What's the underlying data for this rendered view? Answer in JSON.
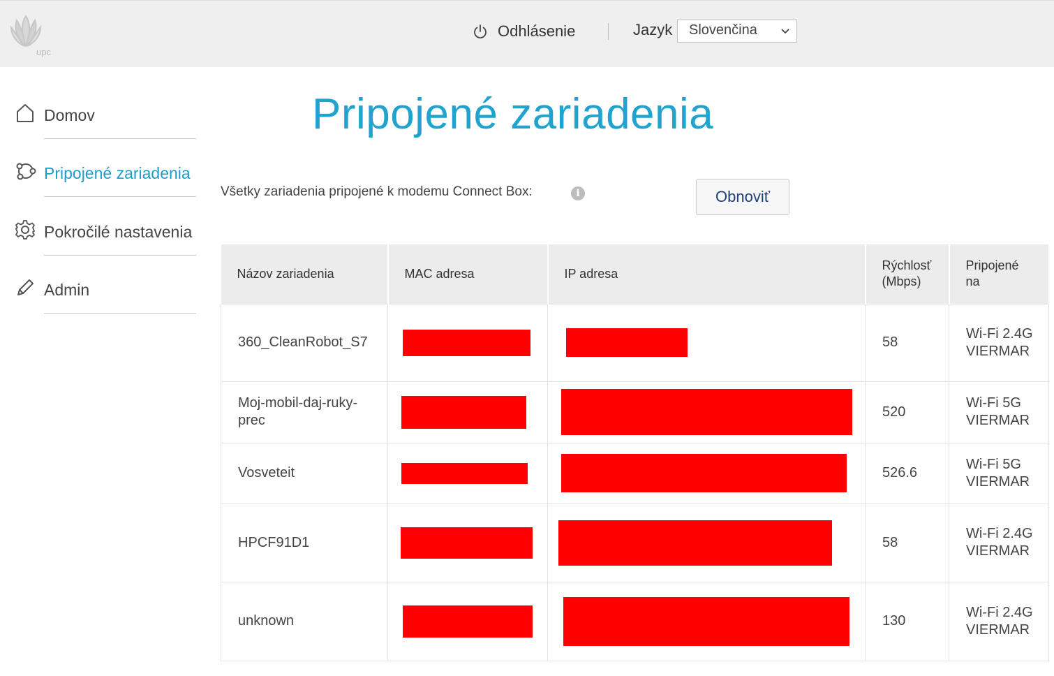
{
  "header": {
    "logo_text": "upc",
    "logout_label": "Odhlásenie",
    "language_label": "Jazyk",
    "language_selected": "Slovenčina"
  },
  "sidebar": {
    "items": [
      {
        "label": "Domov",
        "icon": "home-icon",
        "active": false
      },
      {
        "label": "Pripojené zariadenia",
        "icon": "connected-devices-icon",
        "active": true
      },
      {
        "label": "Pokročilé nastavenia",
        "icon": "gear-icon",
        "active": false
      },
      {
        "label": "Admin",
        "icon": "pencil-icon",
        "active": false
      }
    ]
  },
  "main": {
    "title": "Pripojené zariadenia",
    "subtitle": "Všetky zariadenia pripojené k modemu Connect Box:",
    "info_icon": "i",
    "refresh_label": "Obnoviť"
  },
  "table": {
    "columns": [
      "Názov zariadenia",
      "MAC adresa",
      "IP adresa",
      "Rýchlosť (Mbps)",
      "Pripojené na"
    ],
    "rows": [
      {
        "name": "360_CleanRobot_S7",
        "mac": "",
        "ip": "",
        "speed": "58",
        "connected": "Wi-Fi 2.4G VIERMAR"
      },
      {
        "name": "Moj-mobil-daj-ruky-prec",
        "mac": "",
        "ip": "",
        "speed": "520",
        "connected": "Wi-Fi 5G VIERMAR"
      },
      {
        "name": "Vosveteit",
        "mac": "",
        "ip": "",
        "speed": "526.6",
        "connected": "Wi-Fi 5G VIERMAR"
      },
      {
        "name": "HPCF91D1",
        "mac": "",
        "ip": "",
        "speed": "58",
        "connected": "Wi-Fi 2.4G VIERMAR"
      },
      {
        "name": "unknown",
        "mac": "",
        "ip": "",
        "speed": "130",
        "connected": "Wi-Fi 2.4G VIERMAR"
      }
    ]
  },
  "colors": {
    "accent": "#21a3cf",
    "button_text": "#1e3f7a",
    "redaction": "#ff0000",
    "header_bg": "#efefef"
  }
}
